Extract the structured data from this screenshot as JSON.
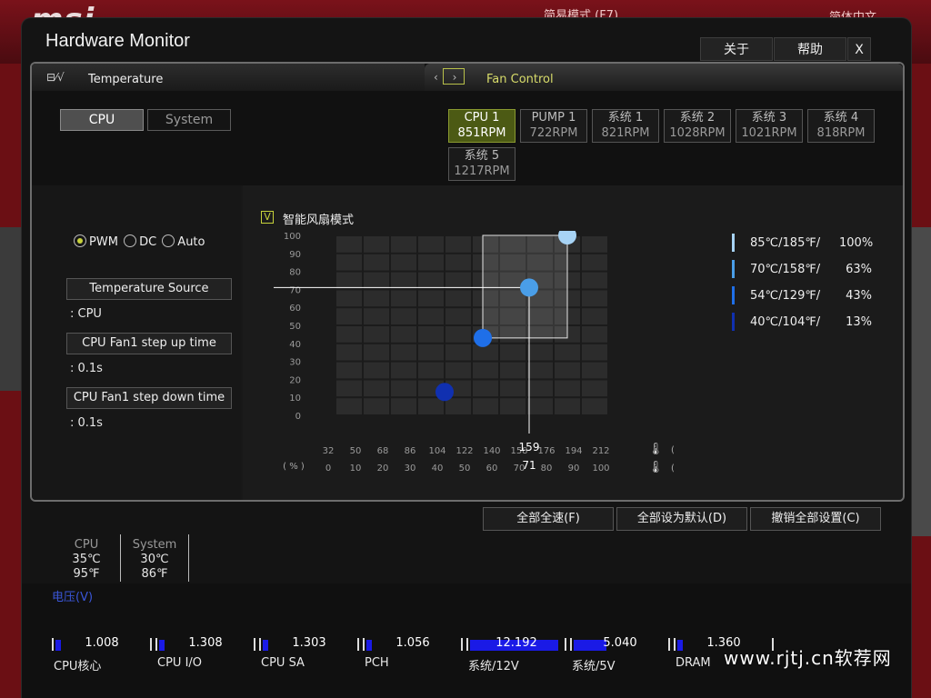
{
  "background": {
    "brand": "msi",
    "simple_mode": "简易模式 (F7)",
    "language": "简体中文"
  },
  "window": {
    "title": "Hardware Monitor",
    "about": "关于",
    "help": "帮助",
    "close": "X"
  },
  "tabs": {
    "temperature": "Temperature",
    "fan_control": "Fan Control"
  },
  "temp_source": {
    "cpu": "CPU",
    "system": "System",
    "selected": "CPU"
  },
  "fans": [
    {
      "name": "CPU 1",
      "rpm": "851RPM",
      "active": true
    },
    {
      "name": "PUMP 1",
      "rpm": "722RPM",
      "active": false
    },
    {
      "name": "系统 1",
      "rpm": "821RPM",
      "active": false
    },
    {
      "name": "系统 2",
      "rpm": "1028RPM",
      "active": false
    },
    {
      "name": "系统 3",
      "rpm": "1021RPM",
      "active": false
    },
    {
      "name": "系统 4",
      "rpm": "818RPM",
      "active": false
    },
    {
      "name": "系统 5",
      "rpm": "1217RPM",
      "active": false
    }
  ],
  "mode": {
    "pwm": "PWM",
    "dc": "DC",
    "auto": "Auto",
    "selected": "PWM"
  },
  "params": {
    "temp_source_label": "Temperature Source",
    "temp_source_value": ": CPU",
    "step_up_label": "CPU Fan1 step up time",
    "step_up_value": ": 0.1s",
    "step_down_label": "CPU Fan1 step down time",
    "step_down_value": ": 0.1s"
  },
  "smart_fan": {
    "label": "智能风扇模式",
    "checked": true,
    "check_glyph": "V"
  },
  "legend": [
    {
      "temp": "85℃/185℉/",
      "pct": "100%",
      "color": "#a7d3f5"
    },
    {
      "temp": "70℃/158℉/",
      "pct": "63%",
      "color": "#4a9ee8"
    },
    {
      "temp": "54℃/129℉/",
      "pct": "43%",
      "color": "#1f6fe8"
    },
    {
      "temp": "40℃/104℉/",
      "pct": "13%",
      "color": "#1030b0"
    }
  ],
  "chart_data": {
    "type": "line",
    "y_ticks": [
      "100",
      "90",
      "80",
      "70",
      "60",
      "50",
      "40",
      "30",
      "20",
      "10",
      "0"
    ],
    "x_ticks_f": [
      "32",
      "50",
      "68",
      "86",
      "104",
      "122",
      "140",
      "158",
      "176",
      "194",
      "212"
    ],
    "x_ticks_c": [
      "0",
      "10",
      "20",
      "30",
      "40",
      "50",
      "60",
      "70",
      "80",
      "90",
      "100"
    ],
    "ylim": [
      0,
      100
    ],
    "xlim": [
      0,
      100
    ],
    "points": [
      {
        "x": 40,
        "y": 13,
        "color": "#1030b0"
      },
      {
        "x": 54,
        "y": 43,
        "color": "#1f6fe8"
      },
      {
        "x": 71,
        "y": 71,
        "color": "#4a9ee8"
      },
      {
        "x": 85,
        "y": 100,
        "color": "#a7d3f5"
      }
    ],
    "cursor": {
      "x_c": "71",
      "x_f": "159",
      "y": "71"
    },
    "unit_pct": "( % )",
    "unit_f": "(℉)",
    "unit_c": "(℃)"
  },
  "buttons": {
    "full_speed": "全部全速(F)",
    "default_all": "全部设为默认(D)",
    "cancel_all": "撤销全部设置(C)"
  },
  "sensors": [
    {
      "name": "CPU",
      "c": "35℃",
      "f": "95℉"
    },
    {
      "name": "System",
      "c": "30℃",
      "f": "86℉"
    }
  ],
  "voltage_title": "电压(V)",
  "voltages": [
    {
      "name": "CPU核心",
      "value": "1.008",
      "fill": 0.06
    },
    {
      "name": "CPU I/O",
      "value": "1.308",
      "fill": 0.06
    },
    {
      "name": "CPU SA",
      "value": "1.303",
      "fill": 0.06
    },
    {
      "name": "PCH",
      "value": "1.056",
      "fill": 0.06
    },
    {
      "name": "系统/12V",
      "value": "12.192",
      "fill": 0.95
    },
    {
      "name": "系统/5V",
      "value": "5.040",
      "fill": 0.35
    },
    {
      "name": "DRAM",
      "value": "1.360",
      "fill": 0.06
    }
  ],
  "watermark": "www.rjtj.cn软荐网"
}
